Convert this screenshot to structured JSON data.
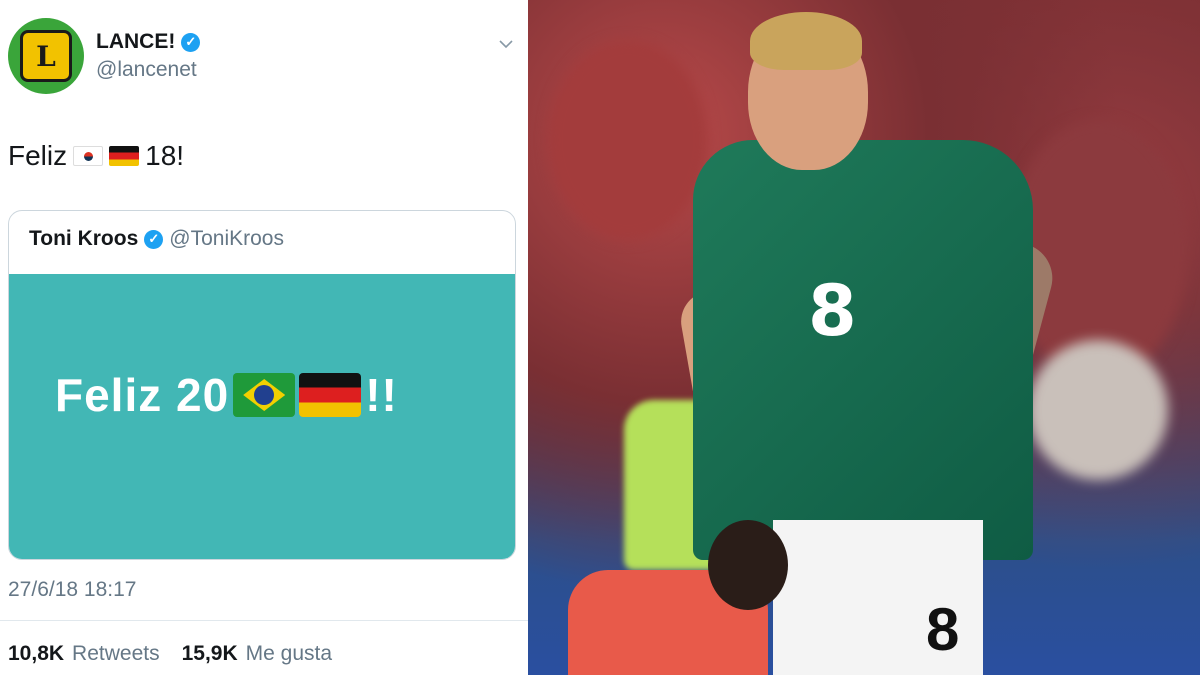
{
  "tweet": {
    "avatar_letter": "L",
    "author_name": "LANCE!",
    "author_handle": "@lancenet",
    "text_prefix": "Feliz",
    "text_suffix": "18!",
    "verified_mark": "✓",
    "quote": {
      "author_name": "Toni Kroos",
      "author_handle": "@ToniKroos",
      "verified_mark": "✓",
      "image_text_prefix": "Feliz 20",
      "image_text_suffix": "!!",
      "image_bg_color": "#42b7b5"
    },
    "timestamp": "27/6/18 18:17",
    "retweets_count": "10,8K",
    "retweets_label": "Retweets",
    "likes_count": "15,9K",
    "likes_label": "Me gusta"
  },
  "photo": {
    "jersey_number": "8",
    "shorts_number": "8",
    "jersey_color": "#1f7a5a"
  },
  "colors": {
    "verified_blue": "#1da1f2",
    "avatar_green": "#3aa53a"
  },
  "icons": [
    "verified-badge-icon",
    "chevron-down-icon",
    "flag-south-korea-icon",
    "flag-germany-icon",
    "flag-brazil-icon"
  ]
}
